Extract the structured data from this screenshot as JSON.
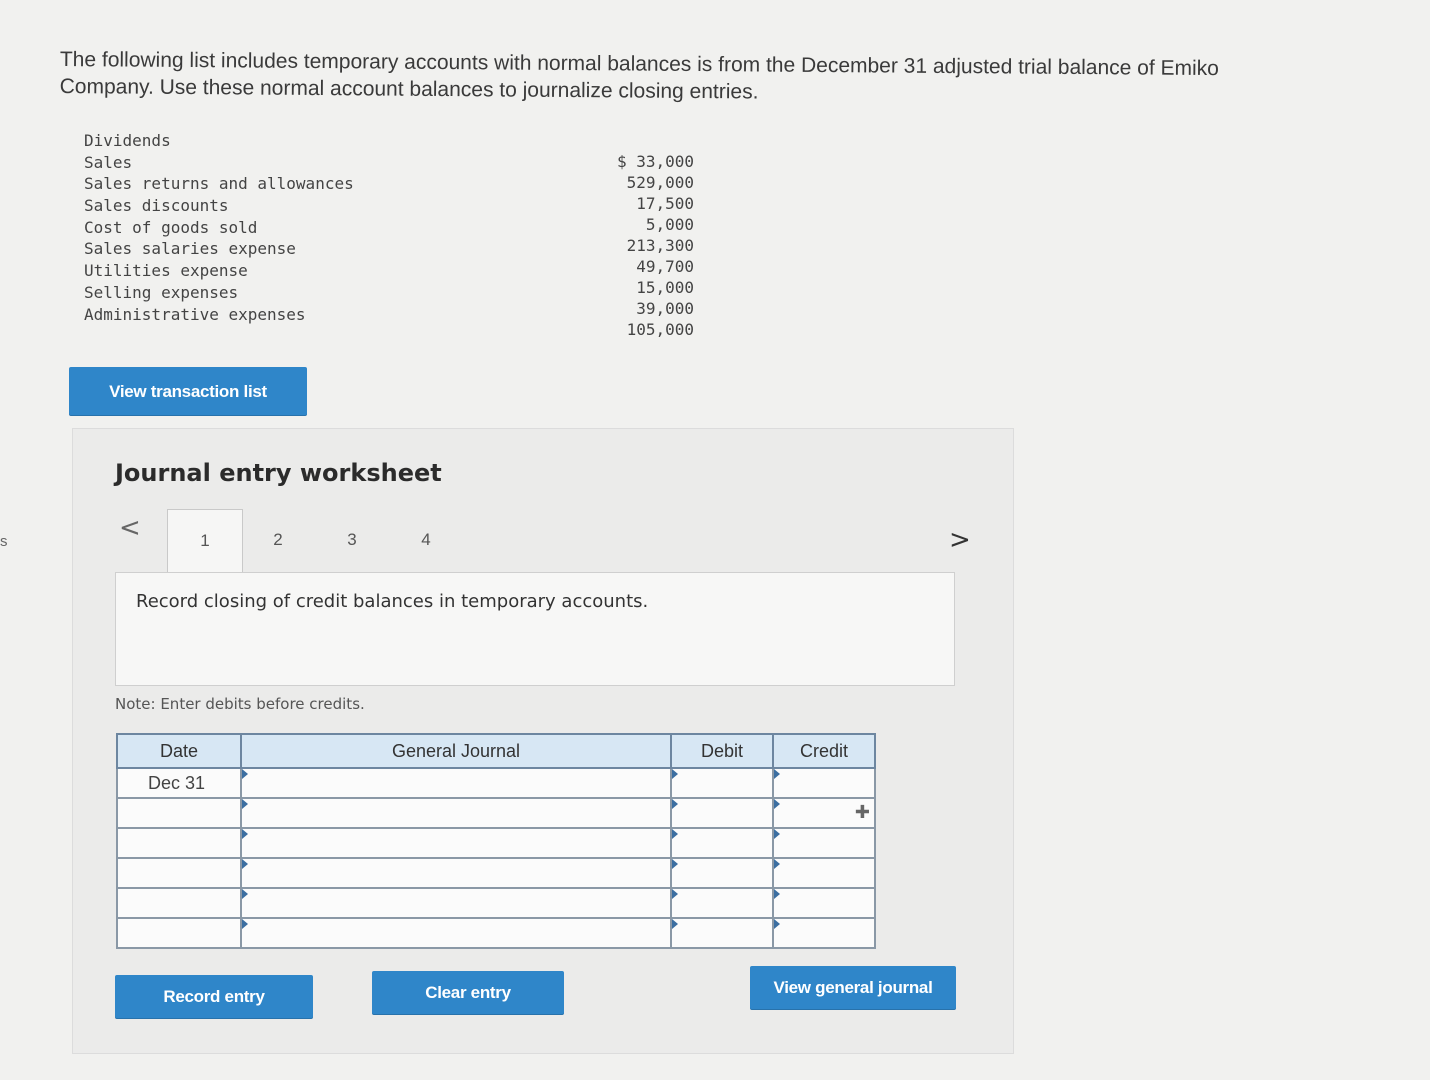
{
  "edge_char": "s",
  "intro_text": "The following list includes temporary accounts with normal balances is from the December 31 adjusted trial balance of Emiko Company. Use these normal account balances to journalize closing entries.",
  "accounts": [
    {
      "name": "Dividends",
      "value": "$ 33,000"
    },
    {
      "name": "Sales",
      "value": "529,000"
    },
    {
      "name": "Sales returns and allowances",
      "value": "17,500"
    },
    {
      "name": "Sales discounts",
      "value": "5,000"
    },
    {
      "name": "Cost of goods sold",
      "value": "213,300"
    },
    {
      "name": "Sales salaries expense",
      "value": "49,700"
    },
    {
      "name": "Utilities expense",
      "value": "15,000"
    },
    {
      "name": "Selling expenses",
      "value": "39,000"
    },
    {
      "name": "Administrative expenses",
      "value": "105,000"
    }
  ],
  "buttons": {
    "view_transaction_list": "View transaction list",
    "record_entry": "Record entry",
    "clear_entry": "Clear entry",
    "view_general_journal": "View general journal"
  },
  "worksheet": {
    "title": "Journal entry worksheet",
    "prev_glyph": "<",
    "next_glyph": ">",
    "tabs": [
      "1",
      "2",
      "3",
      "4"
    ],
    "active_tab": "1",
    "instruction": "Record closing of credit balances in temporary accounts.",
    "note": "Note: Enter debits before credits.",
    "table": {
      "headers": {
        "date": "Date",
        "general_journal": "General Journal",
        "debit": "Debit",
        "credit": "Credit"
      },
      "rows": [
        {
          "date": "Dec 31"
        },
        {
          "date": ""
        },
        {
          "date": ""
        },
        {
          "date": ""
        },
        {
          "date": ""
        },
        {
          "date": ""
        }
      ]
    },
    "add_row_icon": "plus-icon"
  }
}
